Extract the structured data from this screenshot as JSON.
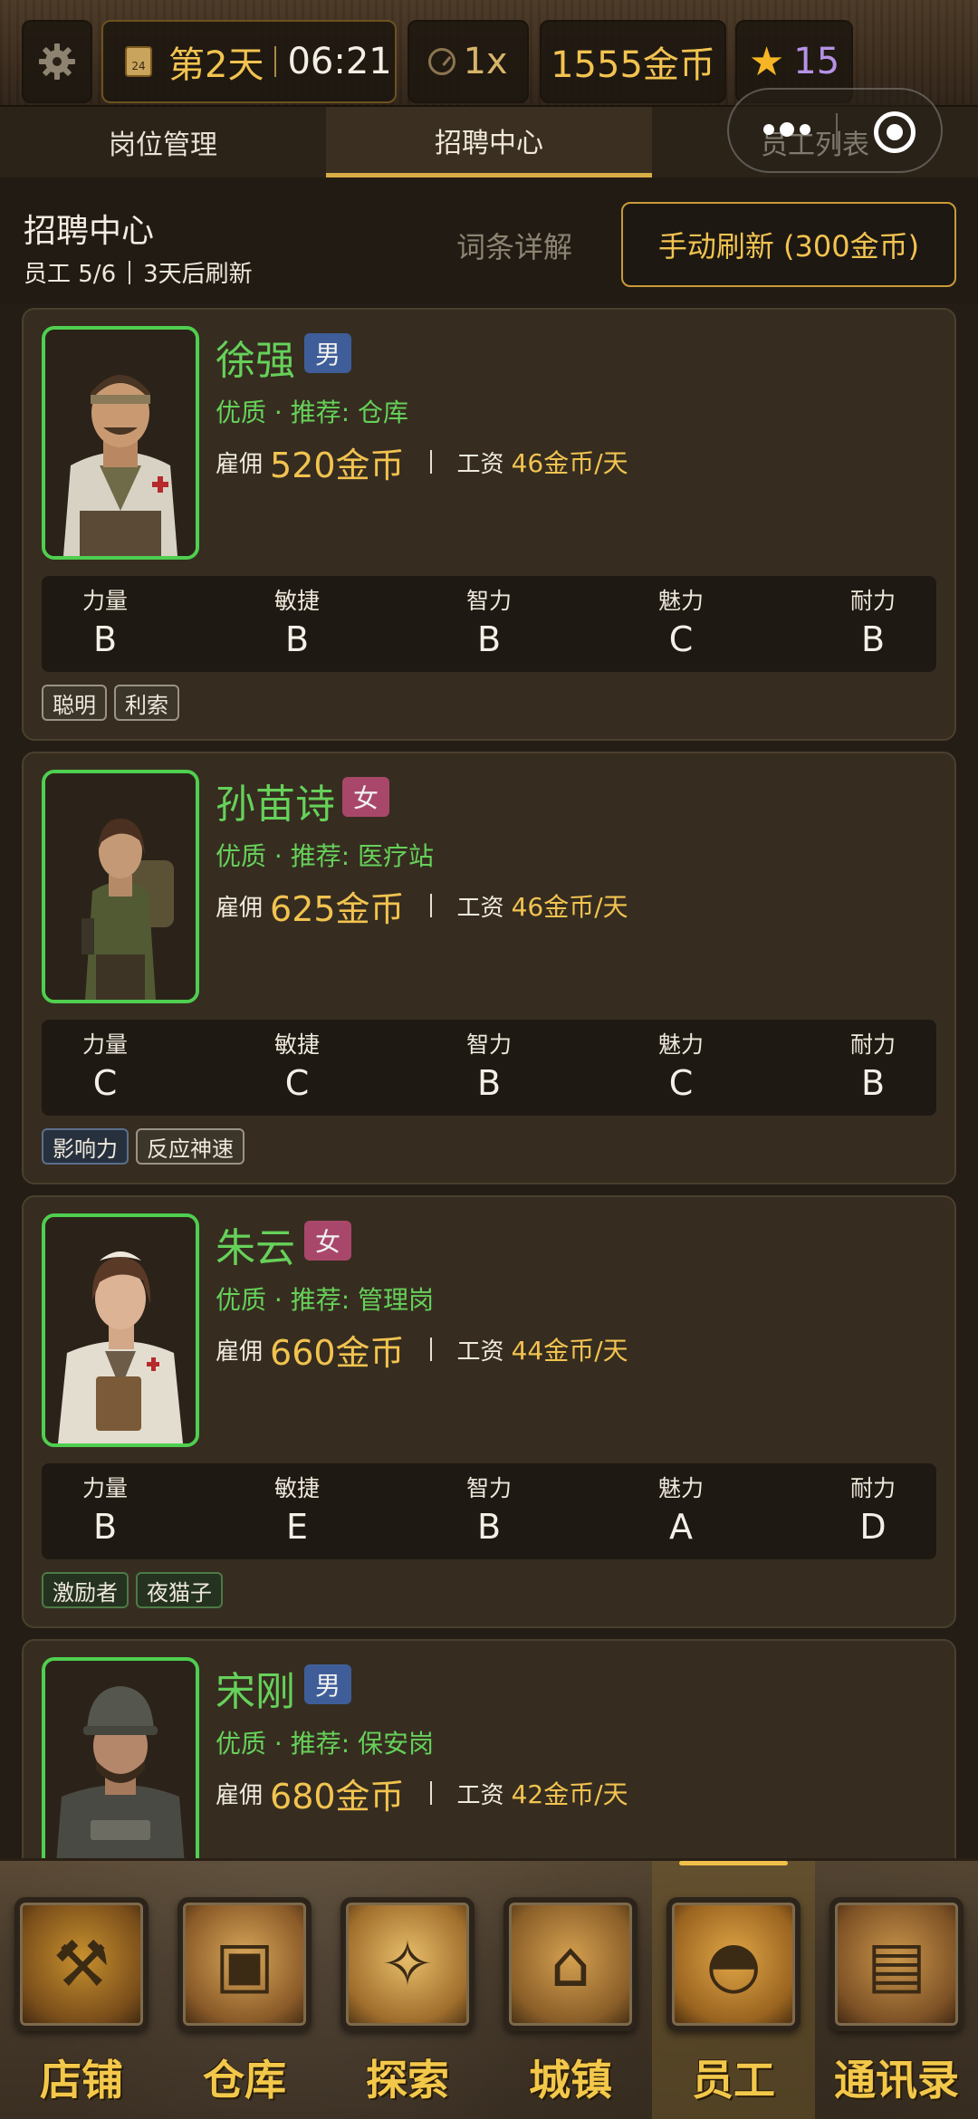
{
  "topbar": {
    "day": "第2天",
    "time": "06:21",
    "calendar_num": "24",
    "speed": "1x",
    "gold": "1555金币",
    "stars": "15"
  },
  "tabs": [
    {
      "label": "岗位管理"
    },
    {
      "label": "招聘中心"
    },
    {
      "label": "员工列表"
    }
  ],
  "recruit": {
    "title": "招聘中心",
    "staff_count": "员工 5/6",
    "refresh_info": "3天后刷新",
    "terms_link": "词条详解",
    "refresh_button": "手动刷新 (300金币)"
  },
  "stat_labels": [
    "力量",
    "敏捷",
    "智力",
    "魅力",
    "耐力"
  ],
  "labels": {
    "hire": "雇佣",
    "wage": "工资"
  },
  "candidates": [
    {
      "name": "徐强",
      "gender": "男",
      "quality": "优质 · 推荐: 仓库",
      "hire_cost": "520金币",
      "wage": "46金币/天",
      "stats": [
        "B",
        "B",
        "B",
        "C",
        "B"
      ],
      "traits": [
        "聪明",
        "利索"
      ]
    },
    {
      "name": "孙苗诗",
      "gender": "女",
      "quality": "优质 · 推荐: 医疗站",
      "hire_cost": "625金币",
      "wage": "46金币/天",
      "stats": [
        "C",
        "C",
        "B",
        "C",
        "B"
      ],
      "traits": [
        "影响力",
        "反应神速"
      ]
    },
    {
      "name": "朱云",
      "gender": "女",
      "quality": "优质 · 推荐: 管理岗",
      "hire_cost": "660金币",
      "wage": "44金币/天",
      "stats": [
        "B",
        "E",
        "B",
        "A",
        "D"
      ],
      "traits": [
        "激励者",
        "夜猫子"
      ]
    },
    {
      "name": "宋刚",
      "gender": "男",
      "quality": "优质 · 推荐: 保安岗",
      "hire_cost": "680金币",
      "wage": "42金币/天",
      "stats": [
        "",
        "",
        "",
        "",
        ""
      ],
      "traits": []
    }
  ],
  "bottom_nav": [
    {
      "label": "店铺",
      "icon": "hammer-icon"
    },
    {
      "label": "仓库",
      "icon": "chest-icon"
    },
    {
      "label": "探索",
      "icon": "compass-icon"
    },
    {
      "label": "城镇",
      "icon": "town-icon"
    },
    {
      "label": "员工",
      "icon": "helmet-icon"
    },
    {
      "label": "通讯录",
      "icon": "book-icon"
    }
  ],
  "colors": {
    "accent_gold": "#f2c350",
    "quality_green": "#66d15a",
    "male_badge": "#3f5e99",
    "female_badge": "#a9476a"
  }
}
